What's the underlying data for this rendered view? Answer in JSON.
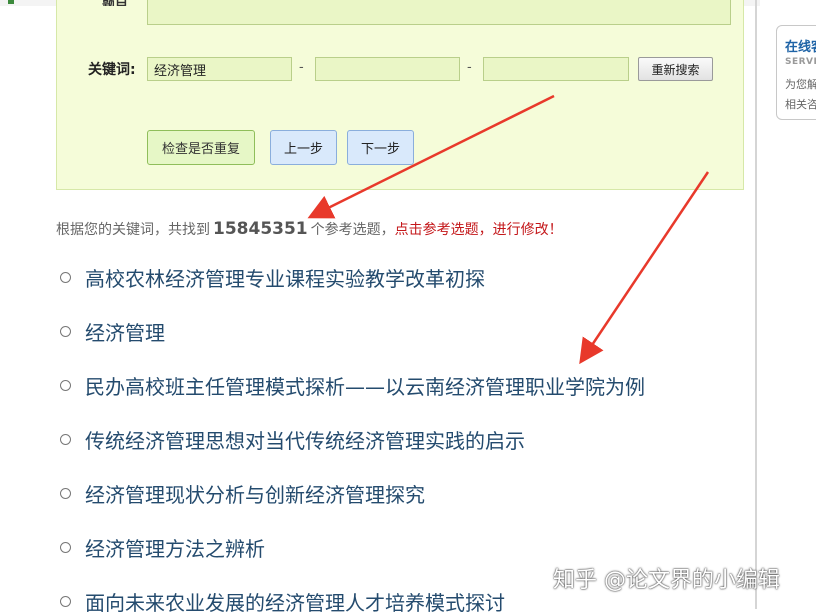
{
  "form": {
    "top_label_fragment": "题目",
    "keyword_label": "关键词:",
    "keyword1_value": "经济管理",
    "keyword2_value": "",
    "keyword3_value": "",
    "dash": "-",
    "reset_label": "重新搜索",
    "check_label": "检查是否重复",
    "prev_label": "上一步",
    "next_label": "下一步"
  },
  "summary": {
    "prefix": "根据您的关键词，共找到",
    "count": "15845351",
    "suffix": "个参考选题，",
    "hint": "点击参考选题，进行修改！"
  },
  "results": [
    "高校农林经济管理专业课程实验教学改革初探",
    "经济管理",
    "民办高校班主任管理模式探析——以云南经济管理职业学院为例",
    "传统经济管理思想对当代传统经济管理实践的启示",
    "经济管理现状分析与创新经济管理探究",
    "经济管理方法之辨析",
    "面向未来农业发展的经济管理人才培养模式探讨"
  ],
  "service": {
    "title": "在线客服",
    "subtitle": "SERVICE",
    "line1": "为您解答",
    "line2": "相关咨询"
  },
  "watermark": "知乎 @论文界的小编辑",
  "colors": {
    "panel_bg": "#f5fcd9",
    "input_bg": "#eaf6c6",
    "link_blue": "#244b6e",
    "hint_red": "#c4171a",
    "arrow_red": "#e8392b"
  }
}
